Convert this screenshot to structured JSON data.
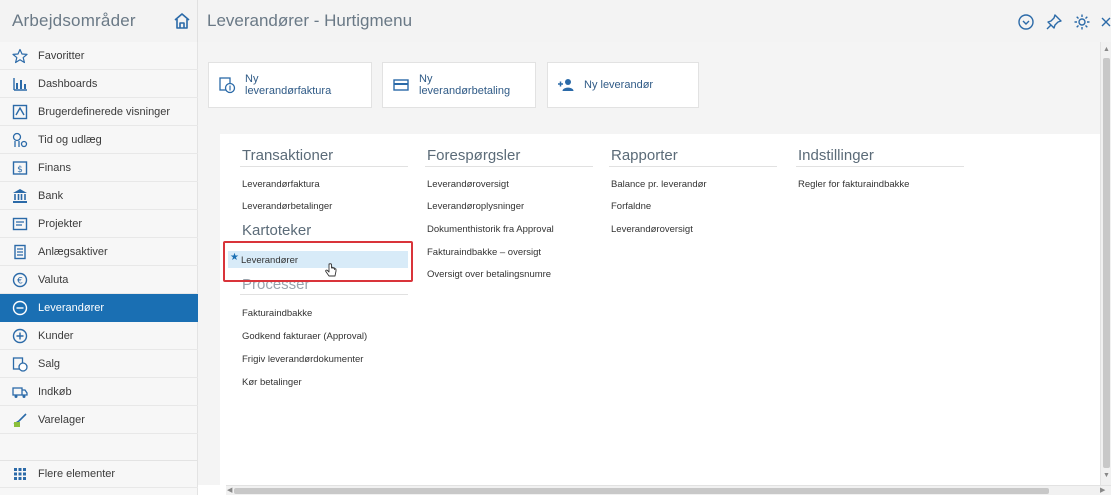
{
  "workspace": {
    "title": "Arbejdsområder"
  },
  "header": {
    "title": "Leverandører - Hurtigmenu"
  },
  "sidebar": {
    "items": [
      {
        "label": "Favoritter",
        "icon": "star-icon"
      },
      {
        "label": "Dashboards",
        "icon": "bar-chart-icon"
      },
      {
        "label": "Brugerdefinerede visninger",
        "icon": "custom-view-icon"
      },
      {
        "label": "Tid og udlæg",
        "icon": "time-expense-icon"
      },
      {
        "label": "Finans",
        "icon": "finance-icon"
      },
      {
        "label": "Bank",
        "icon": "bank-icon"
      },
      {
        "label": "Projekter",
        "icon": "projects-icon"
      },
      {
        "label": "Anlægsaktiver",
        "icon": "assets-icon"
      },
      {
        "label": "Valuta",
        "icon": "currency-icon"
      },
      {
        "label": "Leverandører",
        "icon": "minus-circle-icon",
        "active": true
      },
      {
        "label": "Kunder",
        "icon": "plus-circle-icon"
      },
      {
        "label": "Salg",
        "icon": "sales-icon"
      },
      {
        "label": "Indkøb",
        "icon": "purchase-icon"
      },
      {
        "label": "Varelager",
        "icon": "inventory-icon"
      }
    ],
    "more": {
      "label": "Flere elementer",
      "icon": "grid-dots-icon"
    }
  },
  "quick": {
    "btn1": {
      "line1": "Ny",
      "line2": "leverandørfaktura",
      "icon": "invoice-icon"
    },
    "btn2": {
      "line1": "Ny",
      "line2": "leverandørbetaling",
      "icon": "payment-card-icon"
    },
    "btn3": {
      "label": "Ny leverandør",
      "icon": "add-user-icon"
    }
  },
  "sections": {
    "transaktioner": {
      "title": "Transaktioner",
      "links": [
        "Leverandørfaktura",
        "Leverandørbetalinger"
      ]
    },
    "kartoteker": {
      "title": "Kartoteker",
      "links": [
        "Leverandører"
      ]
    },
    "processer": {
      "title": "Processer",
      "links": [
        "Fakturaindbakke",
        "Godkend fakturaer (Approval)",
        "Frigiv leverandørdokumenter",
        "Kør betalinger"
      ]
    },
    "forespoergsler": {
      "title": "Forespørgsler",
      "links": [
        "Leverandøroversigt",
        "Leverandøroplysninger",
        "Dokumenthistorik fra Approval",
        "Fakturaindbakke – oversigt",
        "Oversigt over betalingsnumre"
      ]
    },
    "rapporter": {
      "title": "Rapporter",
      "links": [
        "Balance pr. leverandør",
        "Forfaldne",
        "Leverandøroversigt"
      ]
    },
    "indstillinger": {
      "title": "Indstillinger",
      "links": [
        "Regler for fakturaindbakke"
      ]
    }
  },
  "colors": {
    "accent": "#1a6fb3",
    "highlight": "#d8ebf8",
    "callout": "#d9343a"
  }
}
